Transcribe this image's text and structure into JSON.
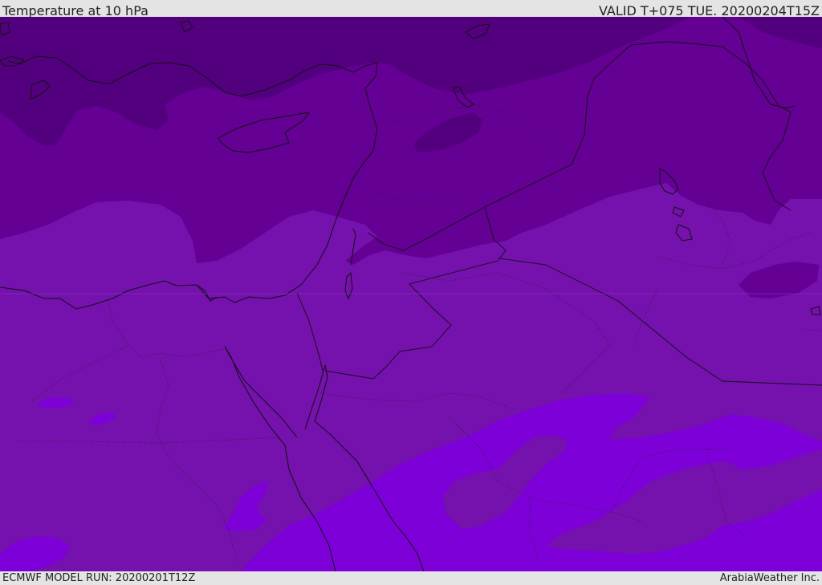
{
  "header": {
    "title": "Temperature at 10 hPa",
    "valid": "VALID T+075 TUE. 20200204T15Z"
  },
  "footer": {
    "model_run": "ECMWF MODEL RUN: 20200201T12Z",
    "credit": "ArabiaWeather Inc."
  },
  "colors": {
    "band_darkest": "#53007f",
    "band_dark": "#640094",
    "band_mid": "#7511ad",
    "band_light": "#7d00d9",
    "coast": "#111111",
    "header_bg": "#e4e4e4"
  }
}
